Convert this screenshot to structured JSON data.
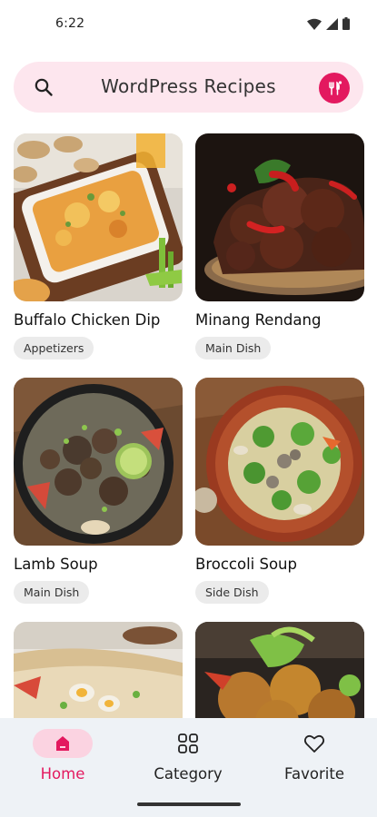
{
  "status_bar": {
    "time": "6:22",
    "icons": [
      "wifi-icon",
      "signal-icon",
      "battery-icon"
    ]
  },
  "search": {
    "title": "WordPress Recipes",
    "icon": "search-icon",
    "badge_icon": "chef-icon"
  },
  "recipes": [
    {
      "name": "Buffalo Chicken Dip",
      "category": "Appetizers"
    },
    {
      "name": "Minang Rendang",
      "category": "Main Dish"
    },
    {
      "name": "Lamb Soup",
      "category": "Main Dish"
    },
    {
      "name": "Broccoli Soup",
      "category": "Side Dish"
    },
    {
      "name": "",
      "category": ""
    },
    {
      "name": "",
      "category": ""
    }
  ],
  "bottom_nav": {
    "items": [
      {
        "label": "Home",
        "icon": "home-icon",
        "active": true
      },
      {
        "label": "Category",
        "icon": "grid-icon",
        "active": false
      },
      {
        "label": "Favorite",
        "icon": "heart-icon",
        "active": false
      }
    ]
  },
  "colors": {
    "accent": "#e3195f",
    "search_bg": "#fde6ee",
    "nav_bg": "#eef2f6",
    "active_pill": "#fbd3e1",
    "tag_bg": "#ebebeb"
  }
}
